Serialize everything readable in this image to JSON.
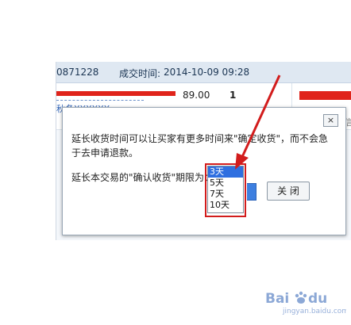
{
  "order": {
    "id_fragment": "0871228",
    "deal_time_label": "成交时间:",
    "deal_time_value": "2014-10-09 09:28",
    "product_link_2": "秋冬XXXXXX",
    "price": "89.00",
    "quantity": "1",
    "right_text": "信"
  },
  "dialog": {
    "close_icon": "×",
    "message": "延长收货时间可以让买家有更多时间来\"确定收货\"，而不会急于去申请退款。",
    "period_label": "延长本交易的\"确认收货\"期限为：",
    "period_options": [
      "3天",
      "5天",
      "7天",
      "10天"
    ],
    "selected_option": "3天",
    "close_button_label": "关 闭"
  },
  "annotation": {
    "highlight_color": "#d21c1c",
    "arrow_color": "#d21c1c"
  },
  "watermark": {
    "brand": "Baidu",
    "sub": "jingyan.baidu.com"
  }
}
